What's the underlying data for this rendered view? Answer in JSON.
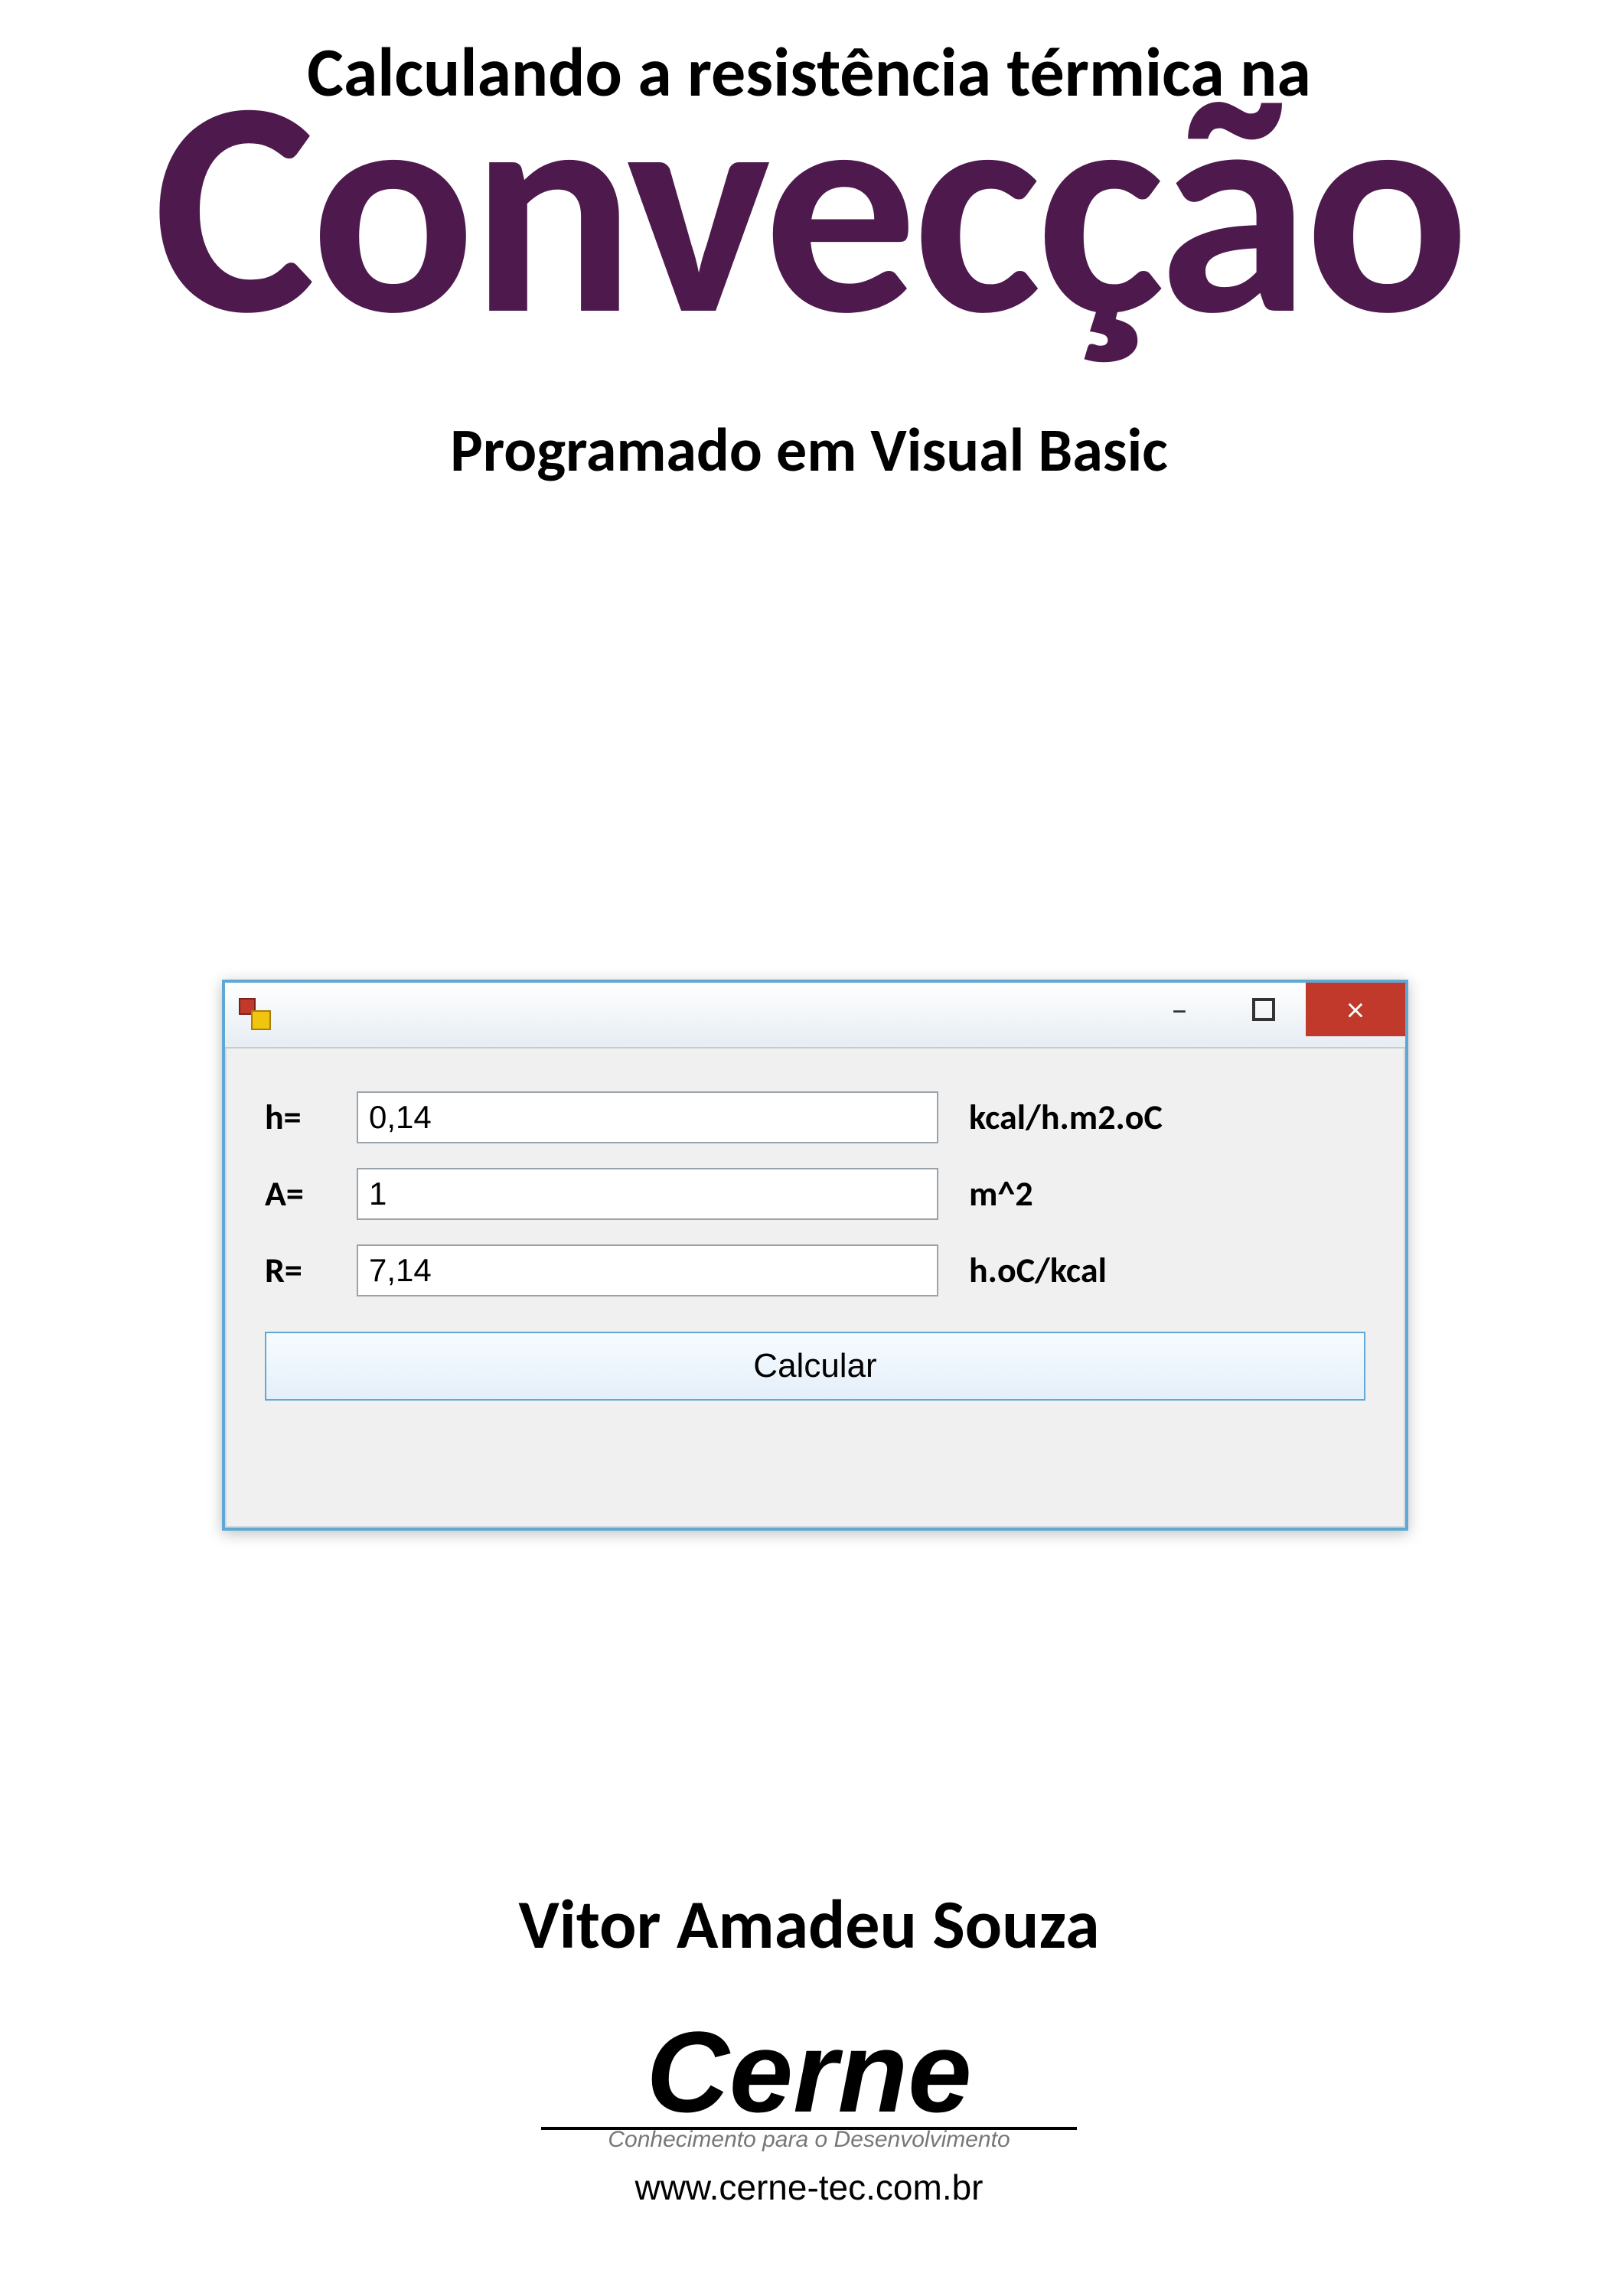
{
  "title": {
    "line1": "Calculando a resistência térmica na",
    "big": "Convecção",
    "line3": "Programado em Visual Basic"
  },
  "window": {
    "controls": {
      "minimize_glyph": "–",
      "close_glyph": "×"
    },
    "form": {
      "rows": [
        {
          "label": "h=",
          "value": "0,14",
          "unit": "kcal/h.m2.oC"
        },
        {
          "label": "A=",
          "value": "1",
          "unit": "m^2"
        },
        {
          "label": "R=",
          "value": "7,14",
          "unit": "h.oC/kcal"
        }
      ],
      "button_label": "Calcular"
    }
  },
  "author": "Vitor Amadeu Souza",
  "logo": {
    "name": "Cerne",
    "tagline": "Conhecimento para o Desenvolvimento",
    "url": "www.cerne-tec.com.br"
  }
}
